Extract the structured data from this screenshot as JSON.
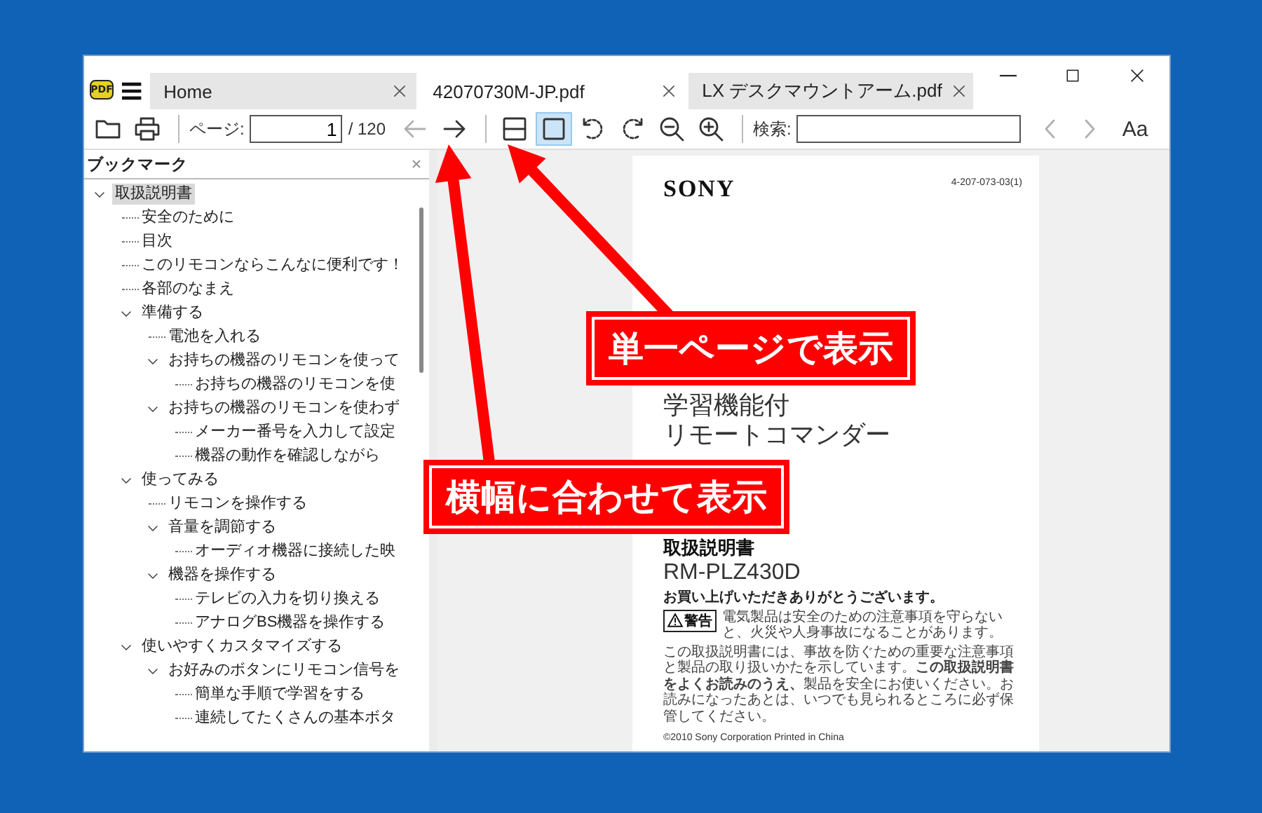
{
  "window": {
    "app_logo": "PDF",
    "tabs": [
      {
        "label": "Home",
        "selected": false
      },
      {
        "label": "42070730M-JP.pdf",
        "selected": true
      },
      {
        "label": "LX デスクマウントアーム.pdf",
        "selected": false
      }
    ]
  },
  "toolbar": {
    "page_label": "ページ:",
    "page_value": "1",
    "page_total": "/ 120",
    "page_nav": [
      {
        "kind": "back",
        "disabled": true
      },
      {
        "kind": "forward",
        "disabled": false
      }
    ],
    "view_modes": [
      {
        "kind": "fit-width",
        "selected": false
      },
      {
        "kind": "single-page",
        "selected": true
      }
    ],
    "tools": [
      {
        "kind": "rotate-left"
      },
      {
        "kind": "rotate-right"
      },
      {
        "kind": "zoom-out"
      },
      {
        "kind": "zoom-in"
      }
    ],
    "search_label": "検索:",
    "search_nav": [
      {
        "kind": "previous",
        "disabled": true
      },
      {
        "kind": "next",
        "disabled": true
      }
    ],
    "match_case": "Aa"
  },
  "bookmarks": {
    "title": "ブックマーク",
    "items": [
      {
        "label": "取扱説明書",
        "selected": true,
        "expanded": true,
        "children": [
          {
            "label": "安全のために",
            "selected": false
          },
          {
            "label": "目次",
            "selected": false
          },
          {
            "label": "このリモコンならこんなに便利です！",
            "selected": false
          },
          {
            "label": "各部のなまえ",
            "selected": false
          },
          {
            "label": "準備する",
            "selected": false,
            "expanded": true,
            "children": [
              {
                "label": "電池を入れる",
                "selected": false
              },
              {
                "label": "お持ちの機器のリモコンを使って",
                "selected": false,
                "expanded": true,
                "children": [
                  {
                    "label": "お持ちの機器のリモコンを使",
                    "selected": false
                  }
                ]
              },
              {
                "label": "お持ちの機器のリモコンを使わず",
                "selected": false,
                "expanded": true,
                "children": [
                  {
                    "label": "メーカー番号を入力して設定",
                    "selected": false
                  },
                  {
                    "label": "機器の動作を確認しながら",
                    "selected": false
                  }
                ]
              }
            ]
          },
          {
            "label": "使ってみる",
            "selected": false,
            "expanded": true,
            "children": [
              {
                "label": "リモコンを操作する",
                "selected": false
              },
              {
                "label": "音量を調節する",
                "selected": false,
                "expanded": true,
                "children": [
                  {
                    "label": "オーディオ機器に接続した映",
                    "selected": false
                  }
                ]
              },
              {
                "label": "機器を操作する",
                "selected": false,
                "expanded": true,
                "children": [
                  {
                    "label": "テレビの入力を切り換える",
                    "selected": false
                  },
                  {
                    "label": "アナログBS機器を操作する",
                    "selected": false
                  }
                ]
              }
            ]
          },
          {
            "label": "使いやすくカスタマイズする",
            "selected": false,
            "expanded": true,
            "children": [
              {
                "label": "お好みのボタンにリモコン信号を",
                "selected": false,
                "expanded": true,
                "children": [
                  {
                    "label": "簡単な手順で学習をする",
                    "selected": false
                  },
                  {
                    "label": "連続してたくさんの基本ボタ",
                    "selected": false
                  }
                ]
              }
            ]
          }
        ]
      }
    ]
  },
  "document": {
    "brand": "SONY",
    "code": "4-207-073-03(1)",
    "product_title": [
      "学習機能付",
      "リモートコマンダー"
    ],
    "heading": "取扱説明書",
    "model": "RM-PLZ430D",
    "thanks": "お買い上げいただきありがとうございます。",
    "warning_label": "警告",
    "warning_text": "電気製品は安全のための注意事項を守らないと、火災や人身事故になることがあります。",
    "notice": "この取扱説明書には、事故を防ぐための重要な注意事項と製品の取り扱いかたを示しています。**この取扱説明書をよくお読みのうえ、**製品を安全にお使いください。お読みになったあとは、いつでも見られるところに必ず保管してください。",
    "copyright": "©2010 Sony Corporation Printed in China"
  },
  "annotations": [
    {
      "text": "単一ページで表示"
    },
    {
      "text": "横幅に合わせて表示"
    }
  ]
}
